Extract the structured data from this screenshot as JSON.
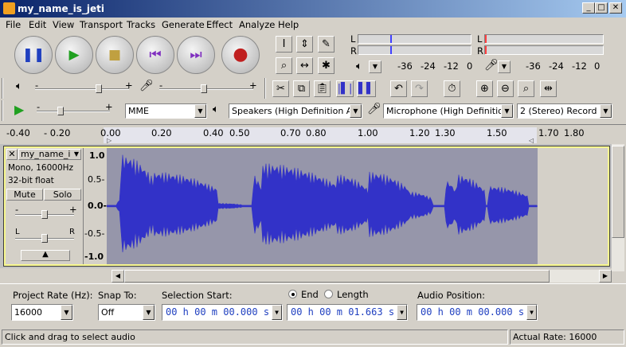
{
  "window": {
    "title": "my_name_is_jeti",
    "minimize": "_",
    "maximize": "□",
    "close": "✕"
  },
  "menu": [
    "File",
    "Edit",
    "View",
    "Transport",
    "Tracks",
    "Generate",
    "Effect",
    "Analyze",
    "Help"
  ],
  "transport": {
    "pause_icon": "pause-icon",
    "play_icon": "play-icon",
    "stop_icon": "stop-icon",
    "skip_start_icon": "skip-to-start-icon",
    "skip_end_icon": "skip-to-end-icon",
    "record_icon": "record-icon"
  },
  "tools": {
    "select": "I",
    "envelope": "⇕",
    "draw": "✎",
    "zoom": "⌕",
    "timeshift": "↔",
    "multi": "✱"
  },
  "meter": {
    "playback_left": "L",
    "playback_right": "R",
    "record_left": "L",
    "record_right": "R",
    "playback_ticks": [
      "-36",
      "-24",
      "-12",
      "0"
    ],
    "record_ticks": [
      "-36",
      "-24",
      "-12",
      "0"
    ]
  },
  "mixer": {
    "min": "-",
    "max": "+"
  },
  "device": {
    "host": "MME",
    "output": "Speakers (High Definition Audio",
    "input": "Microphone (High Definition Au",
    "channels": "2 (Stereo) Record"
  },
  "ruler": {
    "ticks": [
      "-0.40",
      "- 0.20",
      "0.00",
      "0.20",
      "0.40",
      "0.50",
      "0.70",
      "0.80",
      "1.00",
      "1.20",
      "1.30",
      "1.50",
      "1.70",
      "1.80"
    ]
  },
  "track": {
    "name": "my_name_i",
    "info1": "Mono, 16000Hz",
    "info2": "32-bit float",
    "mute": "Mute",
    "solo": "Solo",
    "gain_min": "-",
    "gain_max": "+",
    "pan_left": "L",
    "pan_right": "R",
    "scale": [
      "1.0",
      "0.5-",
      "0.0-",
      "-0.5-",
      "-1.0"
    ],
    "waveform_color": "#3232c8",
    "selected_bg": "#9696aa"
  },
  "bottom": {
    "project_rate_label": "Project Rate (Hz):",
    "project_rate": "16000",
    "snap_label": "Snap To:",
    "snap": "Off",
    "selection_start_label": "Selection Start:",
    "selection_start": "00 h 00 m 00.000 s",
    "end_label": "End",
    "length_label": "Length",
    "selection_end": "00 h 00 m 01.663 s",
    "audio_position_label": "Audio Position:",
    "audio_position": "00 h 00 m 00.000 s"
  },
  "status": {
    "message": "Click and drag to select audio",
    "actual_rate": "Actual Rate: 16000"
  }
}
